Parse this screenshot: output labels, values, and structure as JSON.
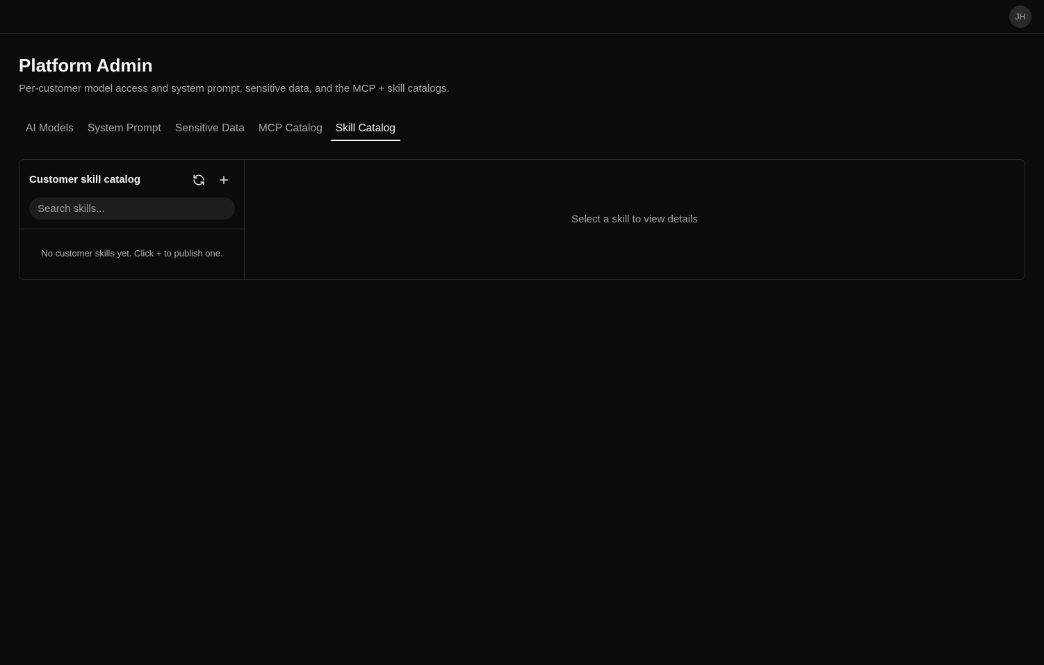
{
  "header": {
    "avatar_initials": "JH"
  },
  "page": {
    "title": "Platform Admin",
    "subtitle": "Per-customer model access and system prompt, sensitive data, and the MCP + skill catalogs."
  },
  "tabs": [
    {
      "label": "AI Models",
      "active": false
    },
    {
      "label": "System Prompt",
      "active": false
    },
    {
      "label": "Sensitive Data",
      "active": false
    },
    {
      "label": "MCP Catalog",
      "active": false
    },
    {
      "label": "Skill Catalog",
      "active": true
    }
  ],
  "skill_catalog": {
    "title": "Customer skill catalog",
    "refresh_icon": "refresh-icon",
    "add_icon": "plus-icon",
    "search_placeholder": "Search skills...",
    "empty_message": "No customer skills yet. Click + to publish one.",
    "detail_placeholder": "Select a skill to view details"
  },
  "colors": {
    "background": "#0b0b0e",
    "border": "#2a2a2e",
    "text_primary": "#f5f5f5",
    "text_muted": "#a3a3a8",
    "input_bg": "#1d1d21"
  }
}
